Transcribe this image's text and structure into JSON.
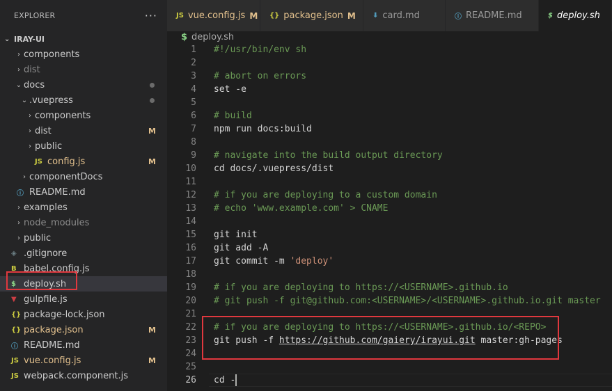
{
  "explorer": {
    "title": "EXPLORER",
    "more": "···",
    "root": "IRAY-UI"
  },
  "colors": {
    "accent_red": "#e0383e",
    "modified": "#e2c08d",
    "comment": "#6a9955",
    "string": "#ce9178",
    "js": "#cbcb41"
  },
  "tree": [
    {
      "label": "components",
      "chevron": "›",
      "icon": "",
      "badge": ""
    },
    {
      "label": "dist",
      "chevron": "›",
      "icon": "",
      "badge": ""
    },
    {
      "label": "docs",
      "chevron": "⌄",
      "icon": "",
      "badge": ""
    },
    {
      "label": ".vuepress",
      "chevron": "⌄",
      "icon": "",
      "badge": ""
    },
    {
      "label": "components",
      "chevron": "›",
      "icon": "",
      "badge": ""
    },
    {
      "label": "dist",
      "chevron": "›",
      "icon": "",
      "badge": "M"
    },
    {
      "label": "public",
      "chevron": "›",
      "icon": "",
      "badge": ""
    },
    {
      "label": "config.js",
      "chevron": "",
      "icon": "JS",
      "badge": "M"
    },
    {
      "label": "componentDocs",
      "chevron": "›",
      "icon": "",
      "badge": ""
    },
    {
      "label": "README.md",
      "chevron": "",
      "icon": "ⓘ",
      "badge": ""
    },
    {
      "label": "examples",
      "chevron": "›",
      "icon": "",
      "badge": ""
    },
    {
      "label": "node_modules",
      "chevron": "›",
      "icon": "",
      "badge": ""
    },
    {
      "label": "public",
      "chevron": "›",
      "icon": "",
      "badge": ""
    },
    {
      "label": ".gitignore",
      "chevron": "",
      "icon": "◈",
      "badge": ""
    },
    {
      "label": "babel.config.js",
      "chevron": "",
      "icon": "B",
      "badge": ""
    },
    {
      "label": "deploy.sh",
      "chevron": "",
      "icon": "$",
      "badge": ""
    },
    {
      "label": "gulpfile.js",
      "chevron": "",
      "icon": "▼",
      "badge": ""
    },
    {
      "label": "package-lock.json",
      "chevron": "",
      "icon": "{}",
      "badge": ""
    },
    {
      "label": "package.json",
      "chevron": "",
      "icon": "{}",
      "badge": "M"
    },
    {
      "label": "README.md",
      "chevron": "",
      "icon": "ⓘ",
      "badge": ""
    },
    {
      "label": "vue.config.js",
      "chevron": "",
      "icon": "JS",
      "badge": "M"
    },
    {
      "label": "webpack.component.js",
      "chevron": "",
      "icon": "JS",
      "badge": ""
    }
  ],
  "tabs": [
    {
      "label": "vue.config.js",
      "icon": "JS",
      "badge": "M"
    },
    {
      "label": "package.json",
      "icon": "{}",
      "badge": "M"
    },
    {
      "label": "card.md",
      "icon": "⬇",
      "badge": ""
    },
    {
      "label": "README.md",
      "icon": "ⓘ",
      "badge": ""
    },
    {
      "label": "deploy.sh",
      "icon": "$",
      "badge": ""
    }
  ],
  "breadcrumb": {
    "icon": "$",
    "file": "deploy.sh"
  },
  "editor": {
    "lines": [
      {
        "n": "1",
        "parts": [
          {
            "t": "#!/usr/bin/env sh",
            "c": "comment"
          }
        ]
      },
      {
        "n": "2",
        "parts": []
      },
      {
        "n": "3",
        "parts": [
          {
            "t": "# abort on errors",
            "c": "comment"
          }
        ]
      },
      {
        "n": "4",
        "parts": [
          {
            "t": "set -e",
            "c": ""
          }
        ]
      },
      {
        "n": "5",
        "parts": []
      },
      {
        "n": "6",
        "parts": [
          {
            "t": "# build",
            "c": "comment"
          }
        ]
      },
      {
        "n": "7",
        "parts": [
          {
            "t": "npm run docs:build",
            "c": ""
          }
        ]
      },
      {
        "n": "8",
        "parts": []
      },
      {
        "n": "9",
        "parts": [
          {
            "t": "# navigate into the build output directory",
            "c": "comment"
          }
        ]
      },
      {
        "n": "10",
        "parts": [
          {
            "t": "cd docs/.vuepress/dist",
            "c": ""
          }
        ]
      },
      {
        "n": "11",
        "parts": []
      },
      {
        "n": "12",
        "parts": [
          {
            "t": "# if you are deploying to a custom domain",
            "c": "comment"
          }
        ]
      },
      {
        "n": "13",
        "parts": [
          {
            "t": "# echo 'www.example.com' > CNAME",
            "c": "comment"
          }
        ]
      },
      {
        "n": "14",
        "parts": []
      },
      {
        "n": "15",
        "parts": [
          {
            "t": "git init",
            "c": ""
          }
        ]
      },
      {
        "n": "16",
        "parts": [
          {
            "t": "git add -A",
            "c": ""
          }
        ]
      },
      {
        "n": "17",
        "parts": [
          {
            "t": "git commit -m ",
            "c": ""
          },
          {
            "t": "'deploy'",
            "c": "string"
          }
        ]
      },
      {
        "n": "18",
        "parts": []
      },
      {
        "n": "19",
        "parts": [
          {
            "t": "# if you are deploying to https://<USERNAME>.github.io",
            "c": "comment"
          }
        ]
      },
      {
        "n": "20",
        "parts": [
          {
            "t": "# git push -f git@github.com:<USERNAME>/<USERNAME>.github.io.git master",
            "c": "comment"
          }
        ]
      },
      {
        "n": "21",
        "parts": []
      },
      {
        "n": "22",
        "parts": [
          {
            "t": "# if you are deploying to https://<USERNAME>.github.io/<REPO>",
            "c": "comment"
          }
        ]
      },
      {
        "n": "23",
        "parts": [
          {
            "t": "git push -f ",
            "c": ""
          },
          {
            "t": "https://github.com/gaiery/irayui.git",
            "c": "link"
          },
          {
            "t": " master:gh-pages",
            "c": ""
          }
        ]
      },
      {
        "n": "24",
        "parts": []
      },
      {
        "n": "25",
        "parts": []
      },
      {
        "n": "26",
        "parts": [
          {
            "t": "cd -",
            "c": ""
          }
        ]
      }
    ],
    "current_line": "26"
  }
}
